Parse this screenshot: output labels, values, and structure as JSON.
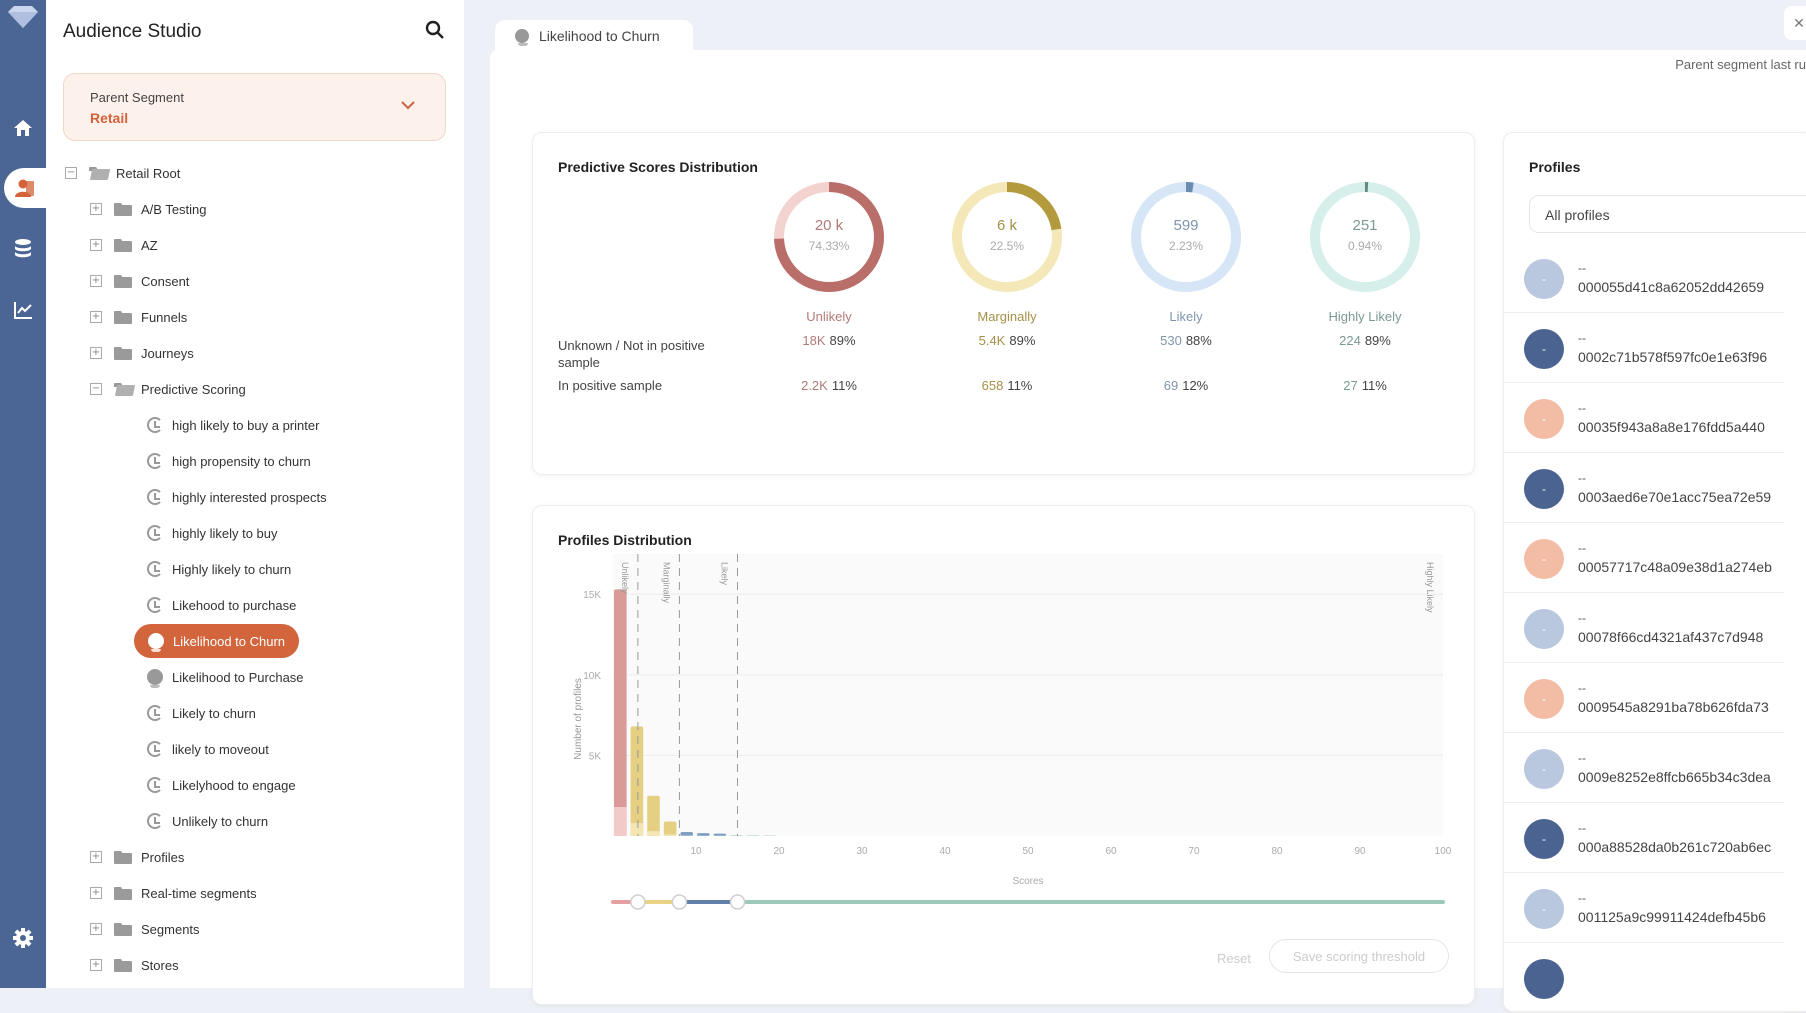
{
  "app": {
    "title": "Audience Studio"
  },
  "rail": {
    "items": [
      "logo",
      "home-icon",
      "audience-icon",
      "database-icon",
      "chart-icon",
      "gear-icon"
    ],
    "active": "audience-icon"
  },
  "parent_segment": {
    "label": "Parent Segment",
    "value": "Retail"
  },
  "tree": {
    "root": "Retail Root",
    "folders_before": [
      "A/B Testing",
      "AZ",
      "Consent",
      "Funnels",
      "Journeys"
    ],
    "expanded_folder": "Predictive Scoring",
    "children": [
      {
        "label": "high likely to buy a printer",
        "icon": "clock"
      },
      {
        "label": "high propensity to churn",
        "icon": "clock"
      },
      {
        "label": "highly interested prospects",
        "icon": "clock"
      },
      {
        "label": "highly likely to buy",
        "icon": "clock"
      },
      {
        "label": "Highly likely to churn",
        "icon": "clock"
      },
      {
        "label": "Likehood to purchase",
        "icon": "clock"
      },
      {
        "label": "Likelihood to Churn",
        "icon": "brain",
        "selected": true
      },
      {
        "label": "Likelihood to Purchase",
        "icon": "brain"
      },
      {
        "label": "Likely to churn",
        "icon": "clock"
      },
      {
        "label": "likely to moveout",
        "icon": "clock"
      },
      {
        "label": "Likelyhood to engage",
        "icon": "clock"
      },
      {
        "label": "Unlikely to churn",
        "icon": "clock"
      }
    ],
    "folders_after": [
      "Profiles",
      "Real-time segments",
      "Segments",
      "Stores"
    ]
  },
  "tab": {
    "label": "Likelihood to Churn",
    "close": "✕"
  },
  "last_run": "Parent segment last ru",
  "predictive": {
    "title": "Predictive Scores Distribution",
    "row_labels": [
      "Unknown / Not in positive sample",
      "In positive sample"
    ],
    "categories": [
      {
        "name": "Unlikely",
        "total": "20 k",
        "pct": "74.33%",
        "share": 0.7433,
        "not_pos": "18K",
        "not_pos_pct": "89%",
        "pos": "2.2K",
        "pos_pct": "11%",
        "color": "#b96e6a",
        "light": "#f3d3d0",
        "text": "#b07a78"
      },
      {
        "name": "Marginally",
        "total": "6 k",
        "pct": "22.5%",
        "share": 0.225,
        "not_pos": "5.4K",
        "not_pos_pct": "89%",
        "pos": "658",
        "pos_pct": "11%",
        "color": "#b39a3c",
        "light": "#f4e8b8",
        "text": "#a59048"
      },
      {
        "name": "Likely",
        "total": "599",
        "pct": "2.23%",
        "share": 0.0223,
        "not_pos": "530",
        "not_pos_pct": "88%",
        "pos": "69",
        "pos_pct": "12%",
        "color": "#6a8cb0",
        "light": "#d6e6f6",
        "text": "#7f95ad"
      },
      {
        "name": "Highly Likely",
        "total": "251",
        "pct": "0.94%",
        "share": 0.0094,
        "not_pos": "224",
        "not_pos_pct": "89%",
        "pos": "27",
        "pos_pct": "11%",
        "color": "#5f8a80",
        "light": "#d6efea",
        "text": "#7b9994"
      }
    ]
  },
  "distribution": {
    "title": "Profiles Distribution",
    "reset": "Reset",
    "save": "Save scoring threshold"
  },
  "chart_data": {
    "type": "bar",
    "title": "Profiles Distribution",
    "xlabel": "Scores",
    "ylabel": "Number of profiles",
    "xlim": [
      0,
      100
    ],
    "ylim": [
      0,
      17000
    ],
    "xticks": [
      10,
      20,
      30,
      40,
      50,
      60,
      70,
      80,
      90,
      100
    ],
    "yticks": [
      {
        "v": 5000,
        "label": "5K"
      },
      {
        "v": 10000,
        "label": "10K"
      },
      {
        "v": 15000,
        "label": "15K"
      }
    ],
    "grid": true,
    "bars": [
      {
        "x0": 0,
        "x1": 2,
        "value": 15300,
        "positive": 1800,
        "category": "Unlikely"
      },
      {
        "x0": 2,
        "x1": 4,
        "value": 6800,
        "positive": 800,
        "category": "Marginally"
      },
      {
        "x0": 4,
        "x1": 6,
        "value": 2500,
        "positive": 300,
        "category": "Marginally"
      },
      {
        "x0": 6,
        "x1": 8,
        "value": 900,
        "positive": 100,
        "category": "Marginally"
      },
      {
        "x0": 8,
        "x1": 10,
        "value": 250,
        "positive": 30,
        "category": "Likely"
      },
      {
        "x0": 10,
        "x1": 12,
        "value": 180,
        "positive": 20,
        "category": "Likely"
      },
      {
        "x0": 12,
        "x1": 14,
        "value": 150,
        "positive": 20,
        "category": "Likely"
      },
      {
        "x0": 14,
        "x1": 16,
        "value": 40,
        "positive": 5,
        "category": "Highly Likely"
      },
      {
        "x0": 16,
        "x1": 18,
        "value": 30,
        "positive": 4,
        "category": "Highly Likely"
      },
      {
        "x0": 18,
        "x1": 20,
        "value": 20,
        "positive": 3,
        "category": "Highly Likely"
      }
    ],
    "thresholds": [
      {
        "x": 3,
        "label": "Unlikely"
      },
      {
        "x": 8,
        "label": "Marginally"
      },
      {
        "x": 15,
        "label": "Likely"
      },
      {
        "x": 100,
        "label": "Highly Likely"
      }
    ],
    "slider": {
      "handles": [
        3,
        8,
        15
      ],
      "colors": [
        "#e4a0a0",
        "#e8d384",
        "#5f7fa8",
        "#9cc9bb"
      ]
    }
  },
  "profiles": {
    "title": "Profiles",
    "filter": "All profiles",
    "items": [
      {
        "name": "--",
        "id": "000055d41c8a62052dd42659",
        "color": "#b9c8de"
      },
      {
        "name": "--",
        "id": "0002c71b578f597fc0e1e63f96",
        "color": "#4a6391"
      },
      {
        "name": "--",
        "id": "00035f943a8a8e176fdd5a440",
        "color": "#f3bca5"
      },
      {
        "name": "--",
        "id": "0003aed6e70e1acc75ea72e59",
        "color": "#4a6391"
      },
      {
        "name": "--",
        "id": "00057717c48a09e38d1a274eb",
        "color": "#f3bca5"
      },
      {
        "name": "--",
        "id": "00078f66cd4321af437c7d948",
        "color": "#b9c8de"
      },
      {
        "name": "--",
        "id": "0009545a8291ba78b626fda73",
        "color": "#f3bca5"
      },
      {
        "name": "--",
        "id": "0009e8252e8ffcb665b34c3dea",
        "color": "#b9c8de"
      },
      {
        "name": "--",
        "id": "000a88528da0b261c720ab6ec",
        "color": "#4a6391"
      },
      {
        "name": "--",
        "id": "001125a9c99911424defb45b6",
        "color": "#b9c8de"
      }
    ],
    "avatar_glyph": "-"
  }
}
